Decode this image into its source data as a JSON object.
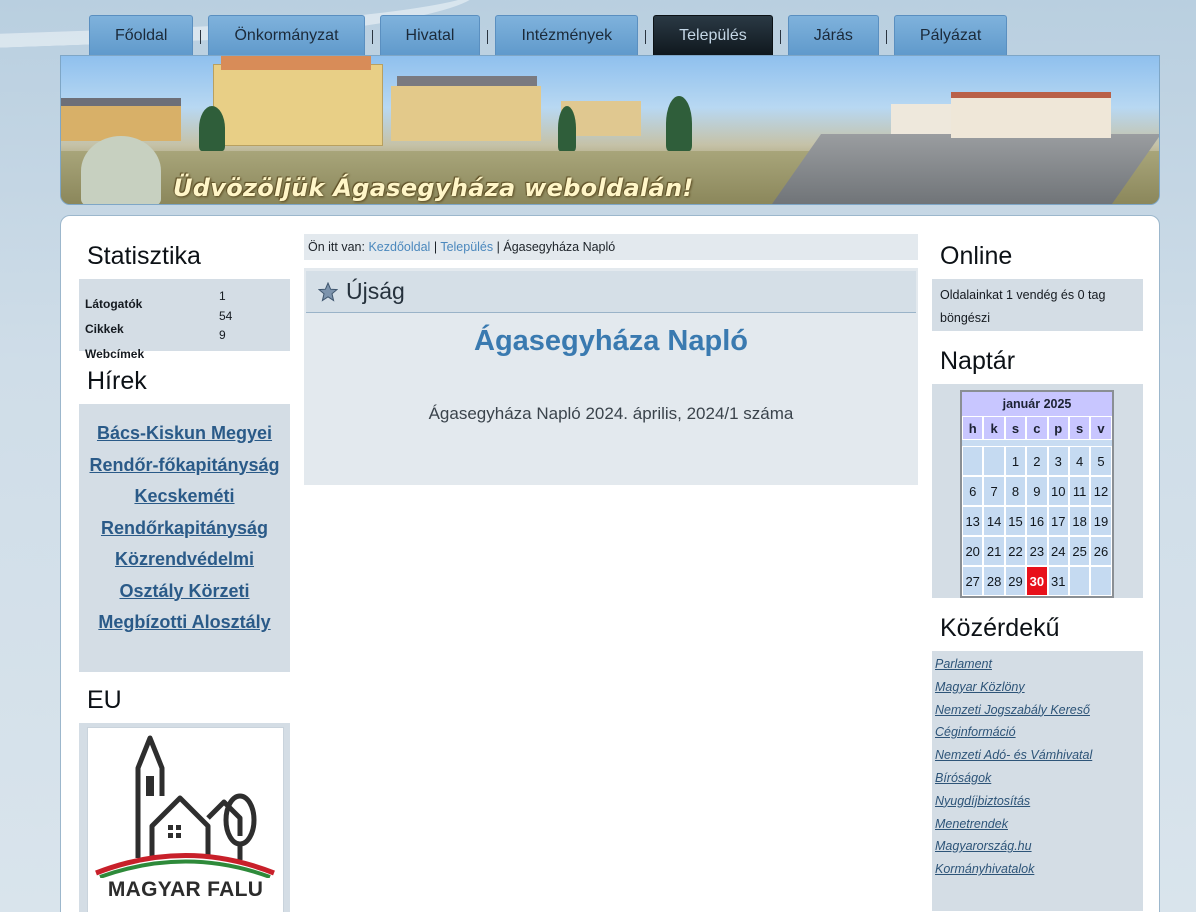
{
  "nav": {
    "tabs": [
      {
        "label": "Főoldal",
        "active": false
      },
      {
        "label": "Önkormányzat",
        "active": false
      },
      {
        "label": "Hivatal",
        "active": false
      },
      {
        "label": "Intézmények",
        "active": false
      },
      {
        "label": "Település",
        "active": true
      },
      {
        "label": "Járás",
        "active": false
      },
      {
        "label": "Pályázat",
        "active": false
      }
    ]
  },
  "banner": {
    "text": "Üdvözöljük Ágasegyháza weboldalán!"
  },
  "left": {
    "stats": {
      "title": "Statisztika",
      "rows": [
        {
          "label": "Látogatók",
          "value": "1"
        },
        {
          "label": "Cikkek",
          "value": "54"
        },
        {
          "label": "Webcímek",
          "value": "9"
        }
      ]
    },
    "news": {
      "title": "Hírek",
      "link": "Bács-Kiskun Megyei Rendőr-főkapitányság Kecskeméti Rendőrkapitányság Közrendvédelmi Osztály Körzeti Megbízotti Alosztály"
    },
    "eu": {
      "title": "EU",
      "logo_text": "MAGYAR FALU"
    }
  },
  "main": {
    "breadcrumb": {
      "prefix": "Ön itt van:",
      "items": [
        "Kezdőoldal",
        "Település"
      ],
      "current": "Ágasegyháza Napló",
      "separator": "|"
    },
    "article": {
      "category": "Újság",
      "title": "Ágasegyháza Napló",
      "body": "Ágasegyháza Napló 2024. április, 2024/1 száma"
    }
  },
  "right": {
    "online": {
      "title": "Online",
      "text": "Oldalainkat 1 vendég és 0 tag böngészi"
    },
    "calendar": {
      "title": "Naptár",
      "month": "január 2025",
      "day_headers": [
        "h",
        "k",
        "s",
        "c",
        "p",
        "s",
        "v"
      ],
      "leading_blanks": 2,
      "days_in_month": 31,
      "today": 30
    },
    "public": {
      "title": "Közérdekű",
      "links": [
        "Parlament",
        "Magyar Közlöny",
        "Nemzeti Jogszabály Kereső",
        "Céginformáció",
        "Nemzeti Adó- és Vámhivatal",
        "Bíróságok",
        "Nyugdíjbiztosítás",
        "Menetrendek",
        "Magyarország.hu",
        "Kormányhivatalok"
      ]
    }
  },
  "colors": {
    "accent": "#3a7ab0",
    "link": "#2a5a88",
    "today": "#e8101a",
    "active_tab": "#1a252d"
  }
}
